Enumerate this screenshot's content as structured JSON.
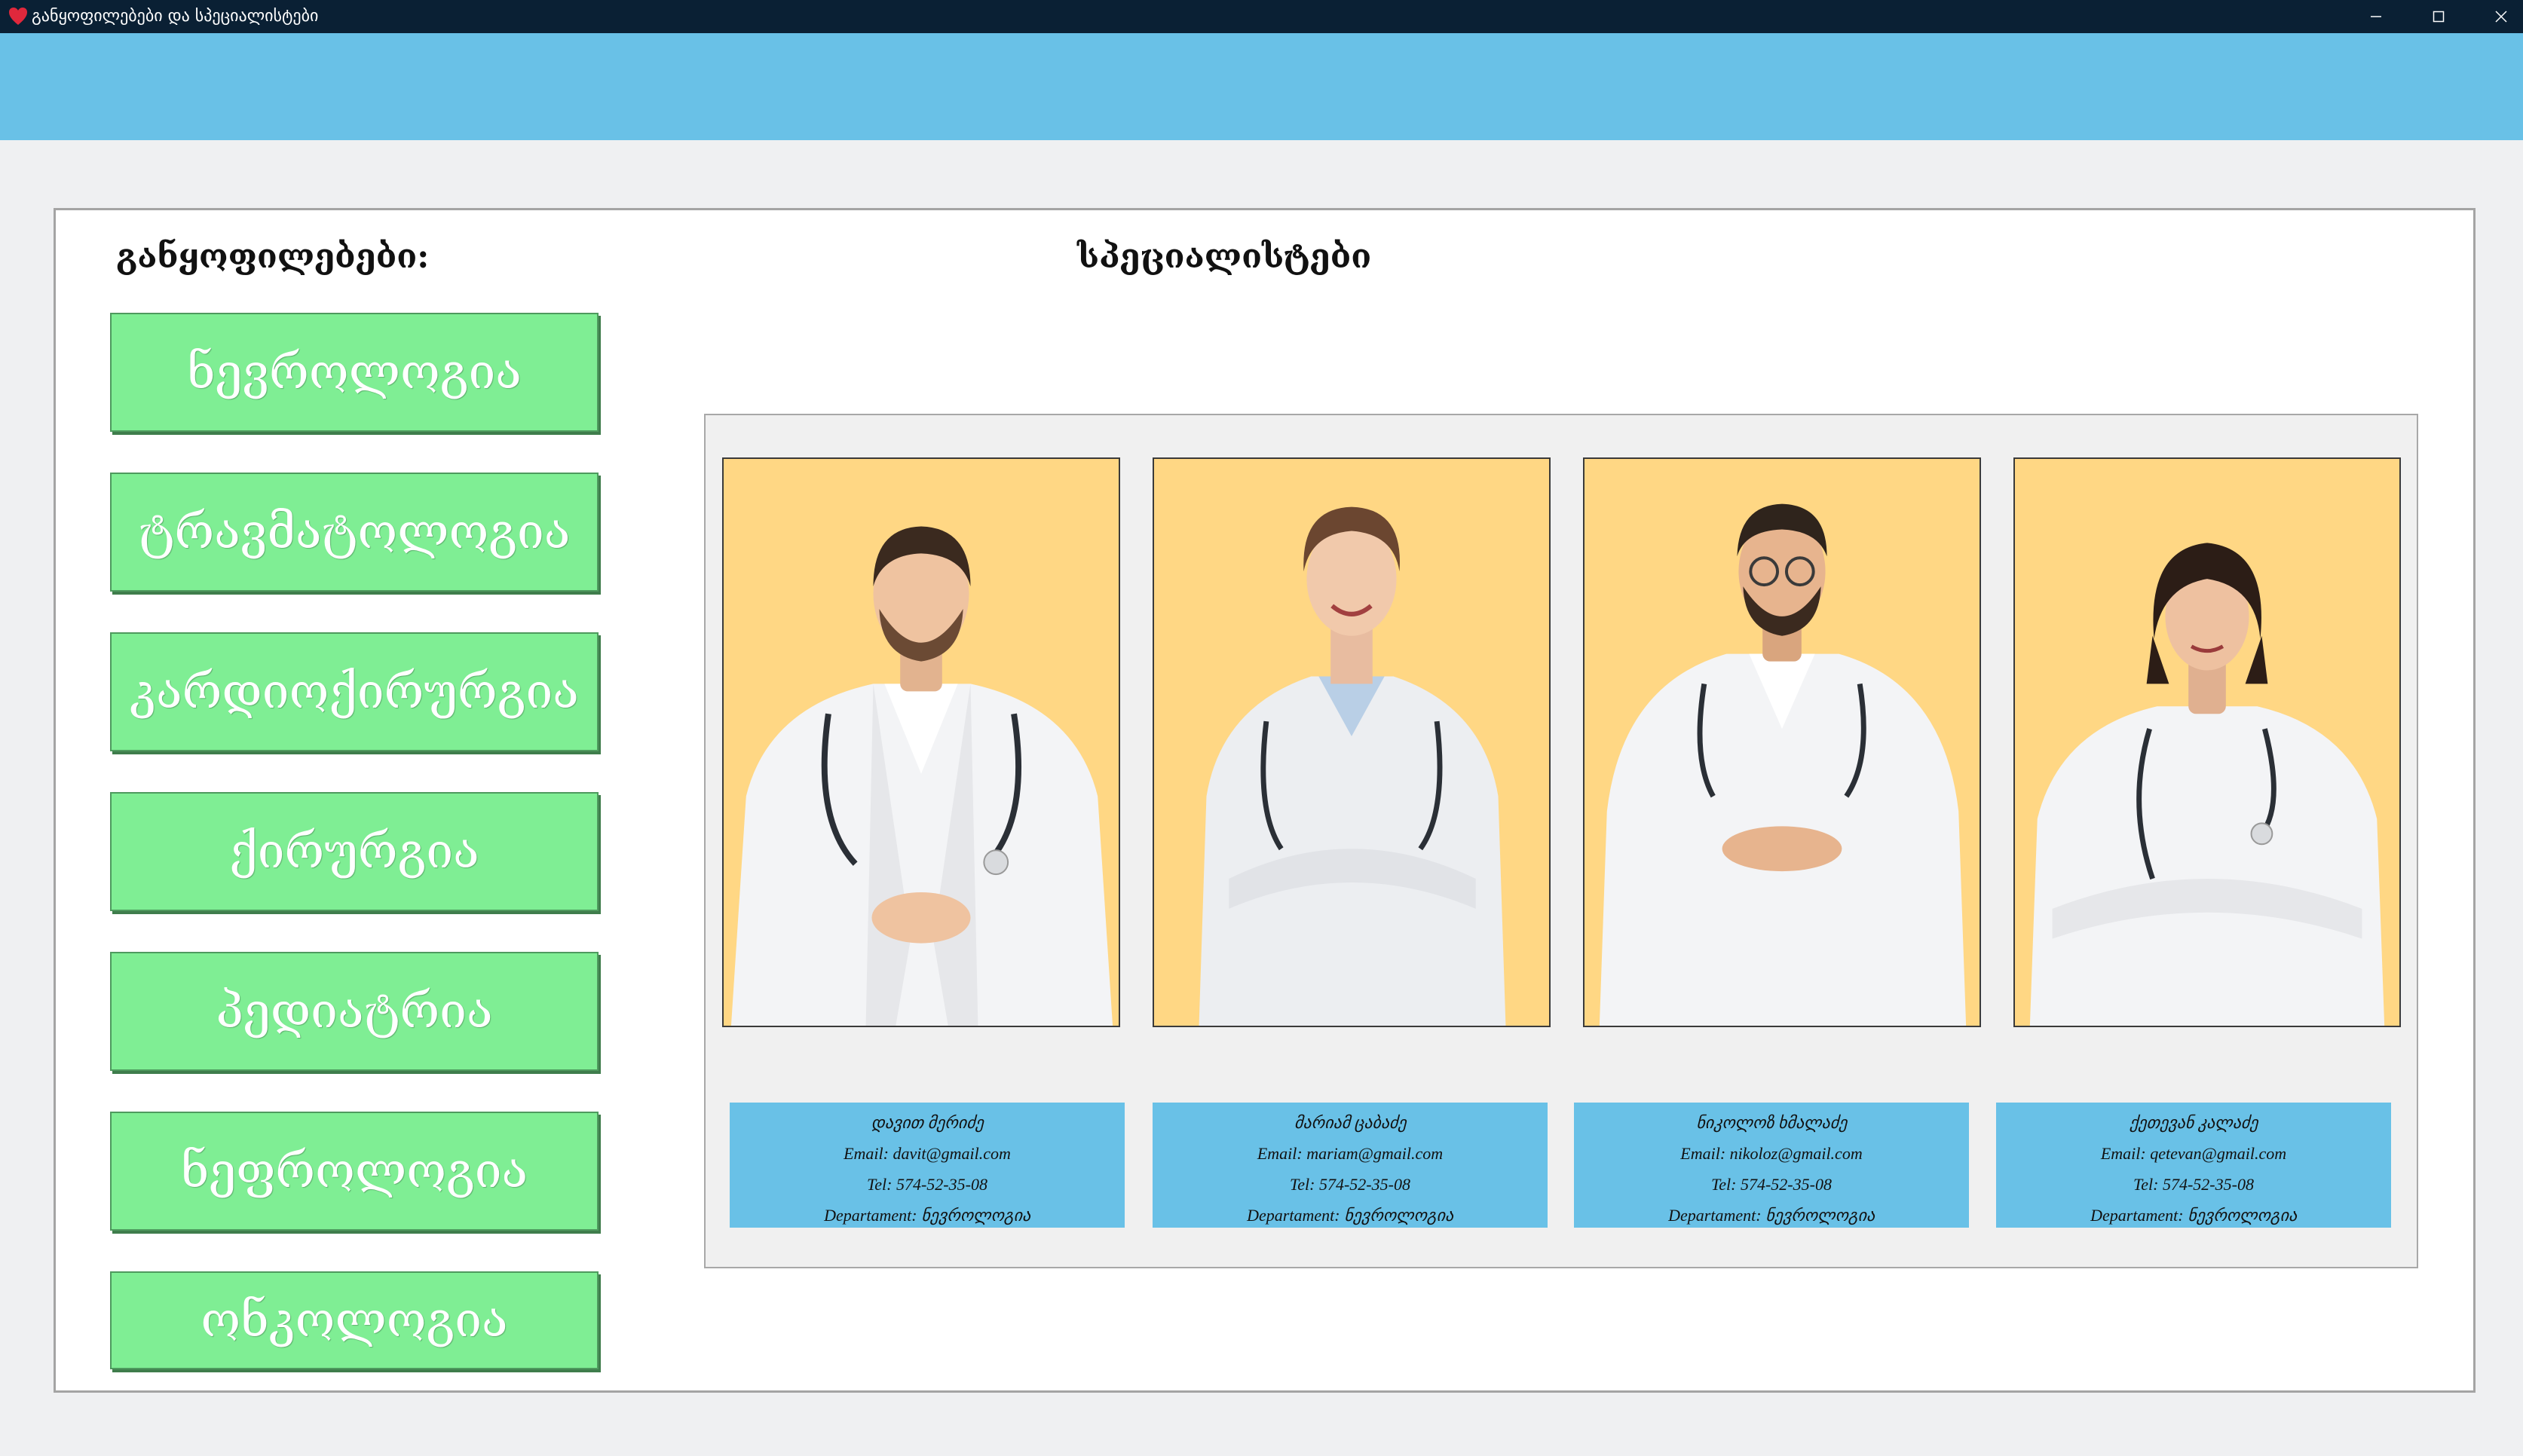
{
  "window": {
    "title": "განყოფილებები და სპეციალისტები",
    "icon": "heart-icon",
    "controls": {
      "minimize": "minimize-icon",
      "maximize": "maximize-icon",
      "close": "close-icon"
    }
  },
  "colors": {
    "titlebar": "#0a2034",
    "header": "#69c1e7",
    "background": "#eff0f2",
    "dept_button": "#7fee94",
    "photo_bg": "#ffd784",
    "info_card": "#69c1e7"
  },
  "departments": {
    "heading": "განყოფილებები:",
    "items": [
      {
        "label": "ნევროლოგია"
      },
      {
        "label": "ტრავმატოლოგია"
      },
      {
        "label": "კარდიოქირურგია"
      },
      {
        "label": "ქირურგია"
      },
      {
        "label": "პედიატრია"
      },
      {
        "label": "ნეფროლოგია"
      },
      {
        "label": "ონკოლოგია"
      }
    ]
  },
  "specialists": {
    "heading": "სპეციალისტები",
    "items": [
      {
        "name": "დავით მერიძე",
        "email": "Email: davit@gmail.com",
        "tel": "Tel: 574-52-35-08",
        "department": "Departament: ნევროლოგია"
      },
      {
        "name": "მარიამ ცაბაძე",
        "email": "Email: mariam@gmail.com",
        "tel": "Tel: 574-52-35-08",
        "department": "Departament: ნევროლოგია"
      },
      {
        "name": "ნიკოლოზ ხმალაძე",
        "email": "Email: nikoloz@gmail.com",
        "tel": "Tel: 574-52-35-08",
        "department": "Departament: ნევროლოგია"
      },
      {
        "name": "ქეთევან კალაძე",
        "email": "Email: qetevan@gmail.com",
        "tel": "Tel: 574-52-35-08",
        "department": "Departament: ნევროლოგია"
      }
    ]
  }
}
